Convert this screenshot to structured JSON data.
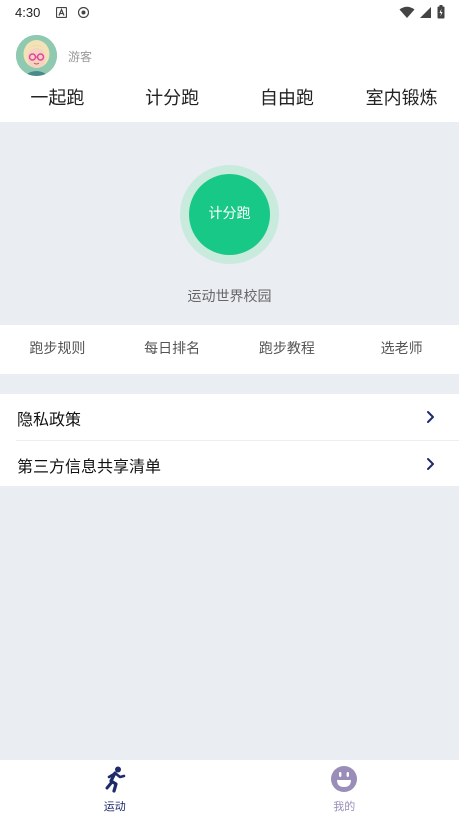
{
  "status_bar": {
    "time": "4:30",
    "icons": [
      "a-icon",
      "shield-icon",
      "wifi-icon",
      "signal-icon",
      "battery-icon"
    ]
  },
  "user": {
    "name": "游客",
    "avatar": "avatar-icon"
  },
  "top_tabs": [
    {
      "label": "一起跑"
    },
    {
      "label": "计分跑"
    },
    {
      "label": "自由跑"
    },
    {
      "label": "室内锻炼"
    }
  ],
  "main": {
    "run_button_label": "计分跑",
    "campus_label": "运动世界校园",
    "accent_color": "#17c886"
  },
  "links": [
    {
      "label": "跑步规则"
    },
    {
      "label": "每日排名"
    },
    {
      "label": "跑步教程"
    },
    {
      "label": "选老师"
    }
  ],
  "menu": [
    {
      "label": "隐私政策",
      "icon": "chevron-right-icon"
    },
    {
      "label": "第三方信息共享清单",
      "icon": "chevron-right-icon"
    }
  ],
  "bottom_nav": [
    {
      "label": "运动",
      "icon": "running-icon",
      "active": true
    },
    {
      "label": "我的",
      "icon": "smiley-icon",
      "active": false
    }
  ]
}
